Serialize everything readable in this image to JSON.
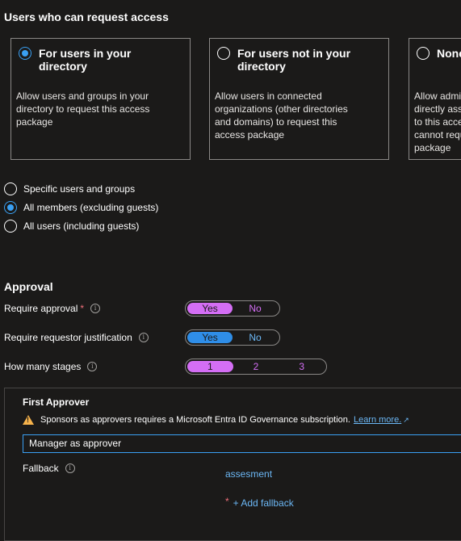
{
  "access": {
    "title": "Users who can request access",
    "cards": [
      {
        "title": "For users in your directory",
        "desc": "Allow users and groups in your directory to request this access package",
        "selected": true
      },
      {
        "title": "For users not in your directory",
        "desc": "Allow users in connected organizations (other directories and domains) to request this access package",
        "selected": false
      },
      {
        "title": "None",
        "desc": "Allow administrators to directly assign specific users to this access package. Users cannot request this access package",
        "selected": false
      }
    ],
    "options": [
      {
        "label": "Specific users and groups",
        "selected": false
      },
      {
        "label": "All members (excluding guests)",
        "selected": true
      },
      {
        "label": "All users (including guests)",
        "selected": false
      }
    ]
  },
  "approval": {
    "title": "Approval",
    "require_approval": {
      "label": "Require approval",
      "required_mark": "*",
      "yes": "Yes",
      "no": "No",
      "value": "Yes",
      "accent": "#d46ef5"
    },
    "justification": {
      "label": "Require requestor justification",
      "yes": "Yes",
      "no": "No",
      "value": "Yes",
      "accent": "#2f8ee8"
    },
    "stages": {
      "label": "How many stages",
      "options": [
        "1",
        "2",
        "3"
      ],
      "value": "1"
    },
    "info_glyph": "i"
  },
  "first_approver": {
    "title": "First Approver",
    "warning_text": "Sponsors as approvers requires a Microsoft Entra ID Governance subscription.",
    "learn_more": "Learn more.",
    "selected_value": "Manager as approver",
    "fallback_label": "Fallback",
    "fallback_value": "assesment",
    "fallback_required_mark": "*",
    "add_fallback": "+ Add fallback"
  }
}
